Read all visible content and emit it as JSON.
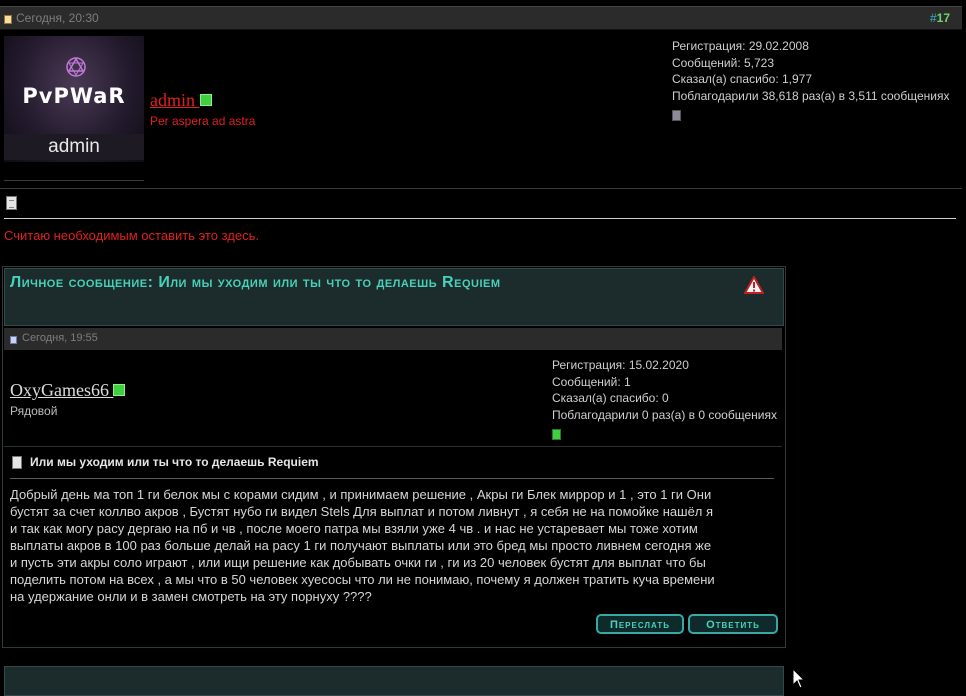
{
  "post": {
    "date": "Сегодня, 20:30",
    "number_hash": "#",
    "number": "17"
  },
  "author": {
    "avatar_logo": "PvPWaR",
    "avatar_caption": "admin",
    "name": "admin",
    "title": "Per aspera ad astra",
    "stats": [
      "Регистрация: 29.02.2008",
      "Сообщений: 5,723",
      "Сказал(а) спасибо: 1,977",
      "Поблагодарили 38,618 раз(а) в 3,511 сообщениях"
    ]
  },
  "message": {
    "intro": "Считаю необходимым оставить это здесь."
  },
  "pm": {
    "title": "Личное сообщение: Или мы уходим или ты что то делаешь Requiem",
    "date": "Сегодня, 19:55",
    "user": "OxyGames66",
    "rank": "Рядовой",
    "stats": [
      "Регистрация: 15.02.2020",
      "Сообщений: 1",
      "Сказал(а) спасибо: 0",
      "Поблагодарили 0 раз(а) в 0 сообщениях"
    ],
    "subject": "Или мы уходим или ты что то делаешь Requiem",
    "body_lines": [
      "Добрый день ма топ 1 ги белок мы с корами сидим , и принимаем решение , Акры ги Блек миррор и 1 , это 1 ги Они",
      "бустят за счет коллво акров , Бустят нубо ги видел Stels Для выплат и потом ливнут , я себя не на помойке нашёл я",
      "и так как могу расу дергаю на пб и чв , после моего патра мы взяли уже 4 чв . и нас не устаревает мы тоже хотим",
      "выплаты акров в 100 раз больше делай на расу 1 ги получают выплаты или это бред мы просто ливнем сегодня же",
      "и пусть эти акры соло играют , или ищи решение как добывать очки ги , ги из 20 человек бустят для выплат что бы",
      "поделить потом на всех , а мы что в 50 человек хуесосы что ли не понимаю, почему я должен тратить куча времени",
      "на удержание онли и в замен смотреть на эту порнуху ????"
    ],
    "buttons": {
      "forward": "Переслать",
      "reply": "Ответить"
    }
  },
  "colors": {
    "accent_red": "#e02020",
    "accent_teal": "#48d1b9",
    "online": "#3fcf3f"
  },
  "icons": [
    "document-icon",
    "online-status-icon",
    "warning-icon",
    "mouse-cursor-icon"
  ]
}
